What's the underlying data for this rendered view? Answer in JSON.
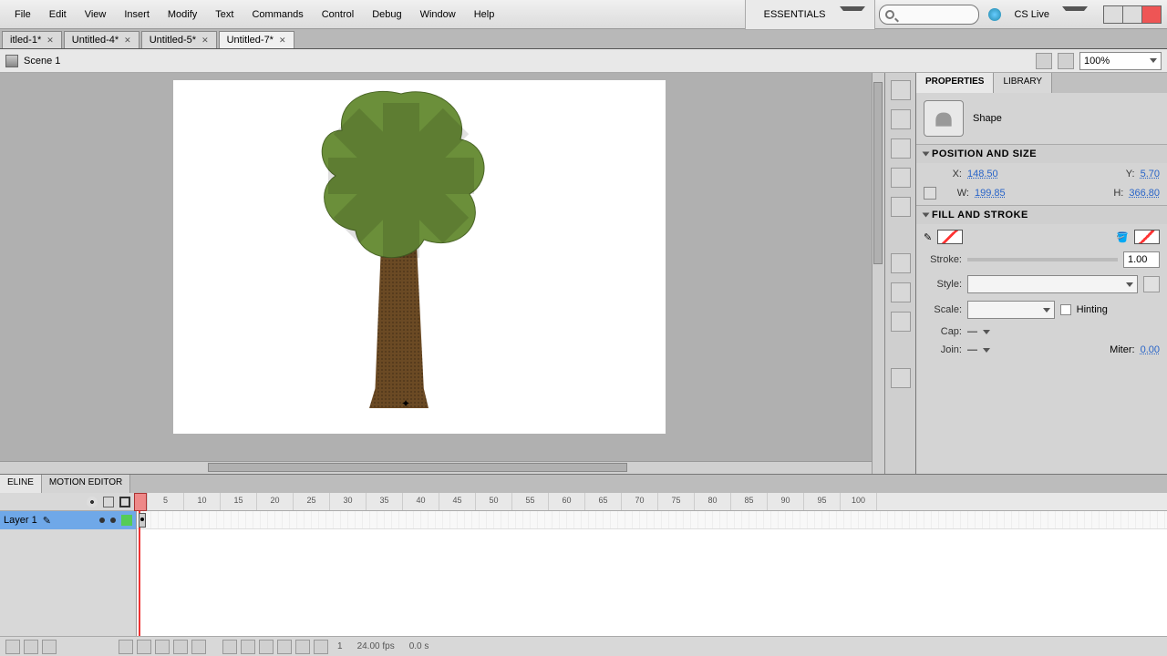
{
  "menu": {
    "items": [
      "File",
      "Edit",
      "View",
      "Insert",
      "Modify",
      "Text",
      "Commands",
      "Control",
      "Debug",
      "Window",
      "Help"
    ]
  },
  "workspace": "ESSENTIALS",
  "cslive": "CS Live",
  "doctabs": [
    {
      "label": "itled-1*"
    },
    {
      "label": "Untitled-4*"
    },
    {
      "label": "Untitled-5*"
    },
    {
      "label": "Untitled-7*",
      "active": true
    }
  ],
  "scene": "Scene 1",
  "zoom": "100%",
  "panel": {
    "tabs": [
      "PROPERTIES",
      "LIBRARY"
    ],
    "typeLabel": "Shape",
    "sections": {
      "posSize": {
        "title": "POSITION AND SIZE",
        "x": "148.50",
        "y": "5.70",
        "w": "199.85",
        "h": "366.80",
        "xl": "X:",
        "yl": "Y:",
        "wl": "W:",
        "hl": "H:"
      },
      "fillStroke": {
        "title": "FILL AND STROKE",
        "strokeLabel": "Stroke:",
        "strokeVal": "1.00",
        "styleLabel": "Style:",
        "scaleLabel": "Scale:",
        "hinting": "Hinting",
        "capLabel": "Cap:",
        "joinLabel": "Join:",
        "miterLabel": "Miter:",
        "miterVal": "0.00"
      }
    }
  },
  "timeline": {
    "tabs": [
      "ELINE",
      "MOTION EDITOR"
    ],
    "layer": "Layer 1",
    "ticks": [
      "1",
      "5",
      "10",
      "15",
      "20",
      "25",
      "30",
      "35",
      "40",
      "45",
      "50",
      "55",
      "60",
      "65",
      "70",
      "75",
      "80",
      "85",
      "90",
      "95",
      "100"
    ],
    "footer": {
      "frame": "1",
      "fps": "24.00 fps",
      "time": "0.0 s"
    }
  }
}
